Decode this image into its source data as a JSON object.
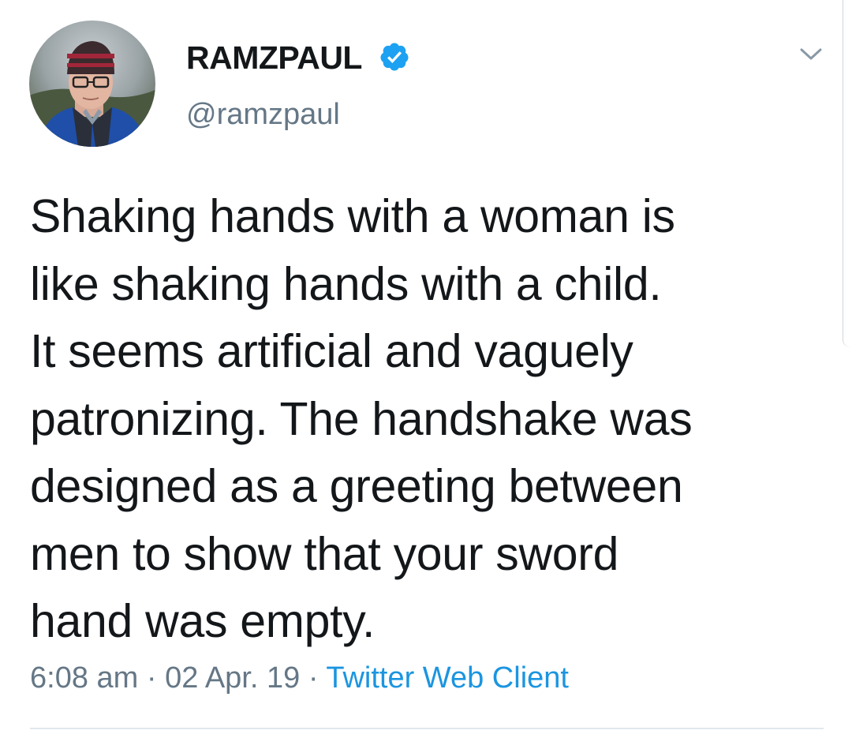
{
  "user": {
    "display_name": "RAMZPAUL",
    "handle": "@ramzpaul",
    "verified": true
  },
  "tweet": {
    "lines": [
      "Shaking hands with a woman is",
      "like shaking hands with a child.",
      "It seems artificial and vaguely",
      "patronizing. The handshake was",
      "designed as a greeting between",
      "men to show that your sword",
      "hand was empty."
    ],
    "time": "6:08 am",
    "date": "02 Apr. 19",
    "separator": "·",
    "source": "Twitter Web Client"
  },
  "icons": {
    "verified": "verified-badge-icon",
    "menu": "chevron-down-icon",
    "avatar": "profile-photo"
  },
  "colors": {
    "text": "#14171a",
    "secondary": "#657786",
    "link": "#1b95e0",
    "verified": "#1da1f2",
    "divider": "#e1e8ed"
  }
}
